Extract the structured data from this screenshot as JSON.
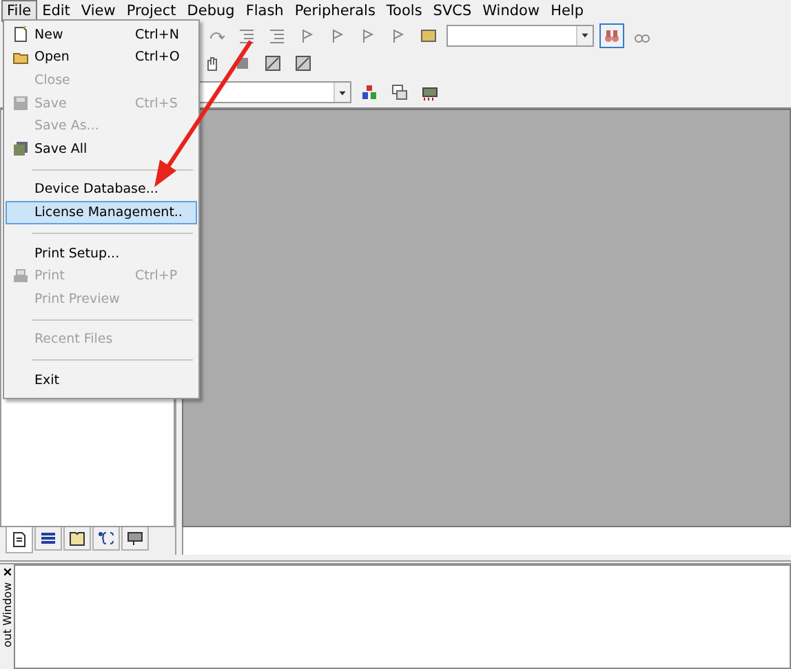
{
  "menubar": [
    {
      "label": "File",
      "selected": true
    },
    {
      "label": "Edit",
      "selected": false
    },
    {
      "label": "View",
      "selected": false
    },
    {
      "label": "Project",
      "selected": false
    },
    {
      "label": "Debug",
      "selected": false
    },
    {
      "label": "Flash",
      "selected": false
    },
    {
      "label": "Peripherals",
      "selected": false
    },
    {
      "label": "Tools",
      "selected": false
    },
    {
      "label": "SVCS",
      "selected": false
    },
    {
      "label": "Window",
      "selected": false
    },
    {
      "label": "Help",
      "selected": false
    }
  ],
  "toolbar": {
    "find_button_pressed": true
  },
  "file_menu": [
    {
      "kind": "item",
      "label": "New",
      "shortcut": "Ctrl+N",
      "disabled": false,
      "selected": false,
      "has_icon": true
    },
    {
      "kind": "item",
      "label": "Open",
      "shortcut": "Ctrl+O",
      "disabled": false,
      "selected": false,
      "has_icon": true
    },
    {
      "kind": "item",
      "label": "Close",
      "disabled": true,
      "selected": false,
      "has_icon": false
    },
    {
      "kind": "item",
      "label": "Save",
      "shortcut": "Ctrl+S",
      "disabled": true,
      "selected": false,
      "has_icon": true
    },
    {
      "kind": "item",
      "label": "Save As...",
      "disabled": true,
      "selected": false,
      "has_icon": false
    },
    {
      "kind": "item",
      "label": "Save All",
      "disabled": false,
      "selected": false,
      "has_icon": true
    },
    {
      "kind": "separator"
    },
    {
      "kind": "item",
      "label": "Device Database...",
      "disabled": false,
      "selected": false,
      "has_icon": false
    },
    {
      "kind": "item",
      "label": "License Management..",
      "disabled": false,
      "selected": true,
      "has_icon": false
    },
    {
      "kind": "separator"
    },
    {
      "kind": "item",
      "label": "Print Setup...",
      "disabled": false,
      "selected": false,
      "has_icon": false
    },
    {
      "kind": "item",
      "label": "Print",
      "shortcut": "Ctrl+P",
      "disabled": true,
      "selected": false,
      "has_icon": true
    },
    {
      "kind": "item",
      "label": "Print Preview",
      "disabled": true,
      "selected": false,
      "has_icon": false
    },
    {
      "kind": "separator"
    },
    {
      "kind": "item",
      "label": "Recent Files",
      "disabled": true,
      "selected": false,
      "has_icon": false
    },
    {
      "kind": "separator"
    },
    {
      "kind": "item",
      "label": "Exit",
      "disabled": false,
      "selected": false,
      "has_icon": false
    }
  ],
  "project_tabs": [
    {
      "selected": true
    },
    {
      "selected": false
    },
    {
      "selected": false
    },
    {
      "selected": false
    },
    {
      "selected": false
    }
  ],
  "output_window": {
    "title": "out Window"
  }
}
